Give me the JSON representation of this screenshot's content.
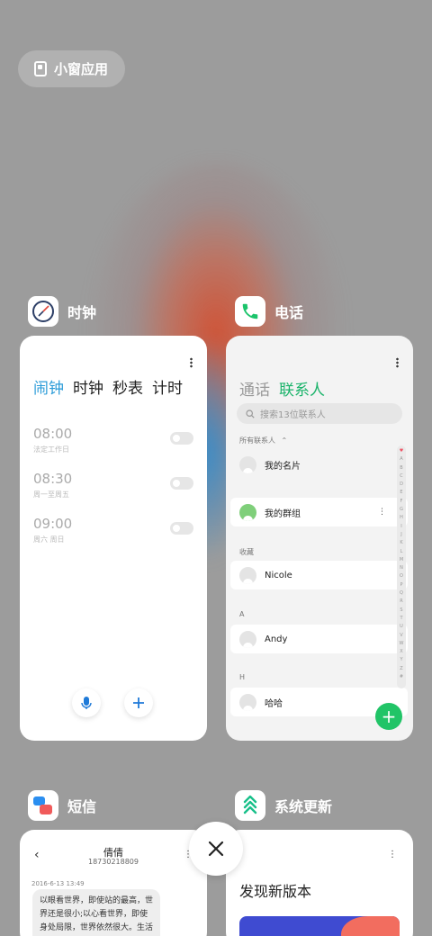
{
  "floating_button": {
    "label": "小窗应用"
  },
  "apps": {
    "clock": {
      "name": "时钟",
      "tabs": [
        "闹钟",
        "时钟",
        "秒表",
        "计时"
      ],
      "active_tab": 0,
      "alarms": [
        {
          "time": "08:00",
          "repeat": "法定工作日"
        },
        {
          "time": "08:30",
          "repeat": "周一至周五"
        },
        {
          "time": "09:00",
          "repeat": "周六 周日"
        }
      ]
    },
    "phone": {
      "name": "电话",
      "tabs": [
        "通话",
        "联系人"
      ],
      "active_tab": 1,
      "search_placeholder": "搜索13位联系人",
      "filter_label": "所有联系人",
      "my_card": "我的名片",
      "my_group": "我的群组",
      "sections": {
        "favorites": "收藏",
        "a": "A",
        "h": "H"
      },
      "contacts": [
        "Nicole",
        "Andy",
        "哈哈"
      ],
      "index_letters": [
        "♥",
        "A",
        "B",
        "C",
        "D",
        "E",
        "F",
        "G",
        "H",
        "I",
        "J",
        "K",
        "L",
        "M",
        "N",
        "O",
        "P",
        "Q",
        "R",
        "S",
        "T",
        "U",
        "V",
        "W",
        "X",
        "Y",
        "Z",
        "#"
      ]
    },
    "sms": {
      "name": "短信",
      "contact_name": "倩倩",
      "contact_number": "18730218809",
      "timestamp": "2016-6-13 13:49",
      "message": "以眼看世界，即使站的最高，世界还是很小;以心看世界，即使身处局限，世界依然很大。生活远不完美，需要用心去体会，不需要在乎"
    },
    "update": {
      "name": "系统更新",
      "headline": "发现新版本"
    }
  },
  "colors": {
    "clock_accent": "#2a9bd8",
    "phone_accent": "#1ab36a",
    "fab": "#21c467"
  }
}
